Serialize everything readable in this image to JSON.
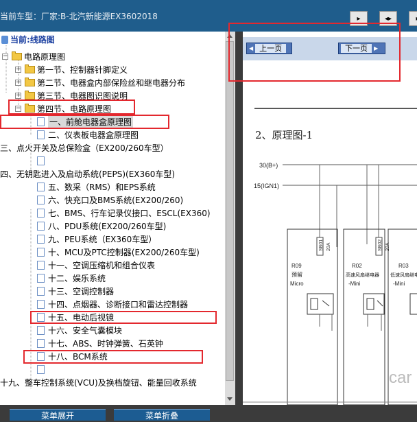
{
  "header": {
    "title": "当前车型：厂家:B-北汽新能源EX3602018",
    "nav_buttons": [
      {
        "name": "single-page-button",
        "glyph": "▸"
      },
      {
        "name": "double-page-button",
        "glyph": "◂▸"
      },
      {
        "name": "fit-page-button",
        "glyph": "▸"
      }
    ]
  },
  "tree": {
    "root": "当前:线路图",
    "items": [
      {
        "label": "电路原理图",
        "type": "folder",
        "toggle": "−"
      },
      {
        "label": "第一节、控制器针脚定义",
        "type": "folder",
        "toggle": "+"
      },
      {
        "label": "第二节、电器盒内部保险丝和继电器分布",
        "type": "folder",
        "toggle": "+"
      },
      {
        "label": "第三节、电器图识图说明",
        "type": "folder",
        "toggle": "+"
      },
      {
        "label": "第四节、电路原理图",
        "type": "folder",
        "toggle": "−"
      },
      {
        "label": "一、前舱电器盒原理图",
        "type": "page",
        "selected": true
      },
      {
        "label": "二、仪表板电器盒原理图",
        "type": "page"
      },
      {
        "label": "三、点火开关及总保险盒（EX200/260车型）",
        "type": "text"
      },
      {
        "label": "",
        "type": "page"
      },
      {
        "label": "四、无钥匙进入及启动系统(PEPS)(EX360车型)",
        "type": "text"
      },
      {
        "label": "五、数采（RMS）和EPS系统",
        "type": "page"
      },
      {
        "label": "六、快充口及BMS系统(EX200/260)",
        "type": "page"
      },
      {
        "label": "七、BMS、行车记录仪接口、ESCL(EX360)",
        "type": "page"
      },
      {
        "label": "八、PDU系统(EX200/260车型)",
        "type": "page"
      },
      {
        "label": "九、PEU系统（EX360车型）",
        "type": "page"
      },
      {
        "label": "十、MCU及PTC控制器(EX200/260车型)",
        "type": "page"
      },
      {
        "label": "十一、空调压缩机和组合仪表",
        "type": "page"
      },
      {
        "label": "十二、娱乐系统",
        "type": "page"
      },
      {
        "label": "十三、空调控制器",
        "type": "page"
      },
      {
        "label": "十四、点烟器、诊断接口和雷达控制器",
        "type": "page"
      },
      {
        "label": "十五、电动后视镜",
        "type": "page"
      },
      {
        "label": "十六、安全气囊模块",
        "type": "page"
      },
      {
        "label": "十七、ABS、时钟弹簧、石英钟",
        "type": "page"
      },
      {
        "label": "十八、BCM系统",
        "type": "page"
      },
      {
        "label": "",
        "type": "page"
      },
      {
        "label": "十九、整车控制系统(VCU)及换档旋钮、能量回收系统",
        "type": "text"
      }
    ]
  },
  "document": {
    "prev_button": "上一页",
    "next_button": "下一页",
    "heading": "2、原理图-1",
    "line_labels": [
      "30(B+)",
      "15(IGN1)"
    ],
    "fuses": [
      {
        "id": "SB01",
        "rating": "20A"
      },
      {
        "id": "SB02",
        "rating": "20A"
      }
    ],
    "relays": [
      {
        "id": "R09",
        "name": "预留",
        "type": "Micro"
      },
      {
        "id": "R02",
        "name": "高速风扇继电器",
        "type": "-Mini"
      },
      {
        "id": "R03",
        "name": "低速风扇继电器",
        "type": "-Mini"
      }
    ],
    "watermark": "car"
  },
  "bottom": {
    "expand_label": "菜单展开",
    "collapse_label": "菜单折叠"
  },
  "colors": {
    "titlebar": "#1f5d8c",
    "annotation_red": "#e3282e",
    "selection": "#d9d9d9"
  }
}
